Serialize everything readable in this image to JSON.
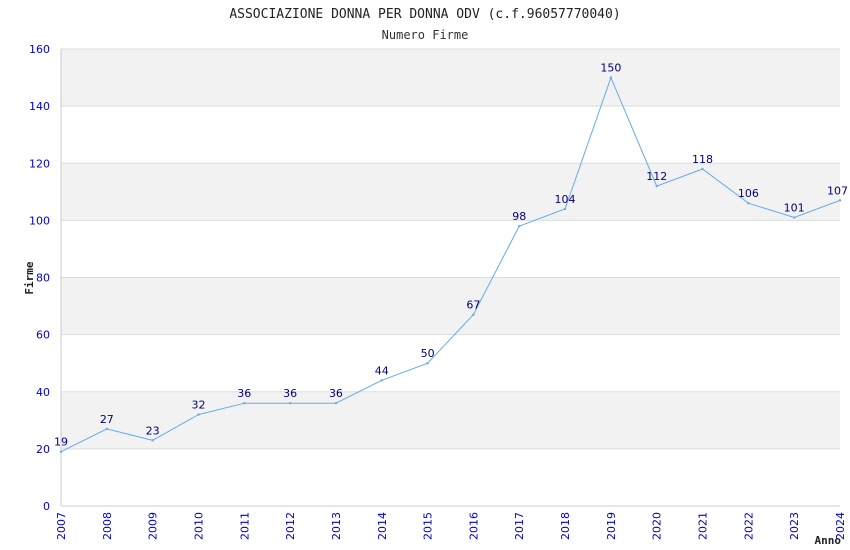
{
  "colors": {
    "band": "#f2f2f2",
    "grid": "#dddddd",
    "line": "#66aaee",
    "tick_text": "#0000cc",
    "data_label": "#000080",
    "axis_line": "#cccccc"
  },
  "chart_data": {
    "type": "line",
    "title": "ASSOCIAZIONE DONNA PER DONNA ODV (c.f.96057770040)",
    "subtitle": "Numero Firme",
    "xlabel": "Anno",
    "ylabel": "Firme",
    "x": [
      "2007",
      "2008",
      "2009",
      "2010",
      "2011",
      "2012",
      "2013",
      "2014",
      "2015",
      "2016",
      "2017",
      "2018",
      "2019",
      "2020",
      "2021",
      "2022",
      "2023",
      "2024"
    ],
    "values": [
      19,
      27,
      23,
      32,
      36,
      36,
      36,
      44,
      50,
      67,
      98,
      104,
      150,
      112,
      118,
      106,
      101,
      107
    ],
    "ylim": [
      0,
      160
    ],
    "yticks": [
      0,
      20,
      40,
      60,
      80,
      100,
      120,
      140,
      160
    ],
    "grid": true,
    "legend": "none"
  }
}
